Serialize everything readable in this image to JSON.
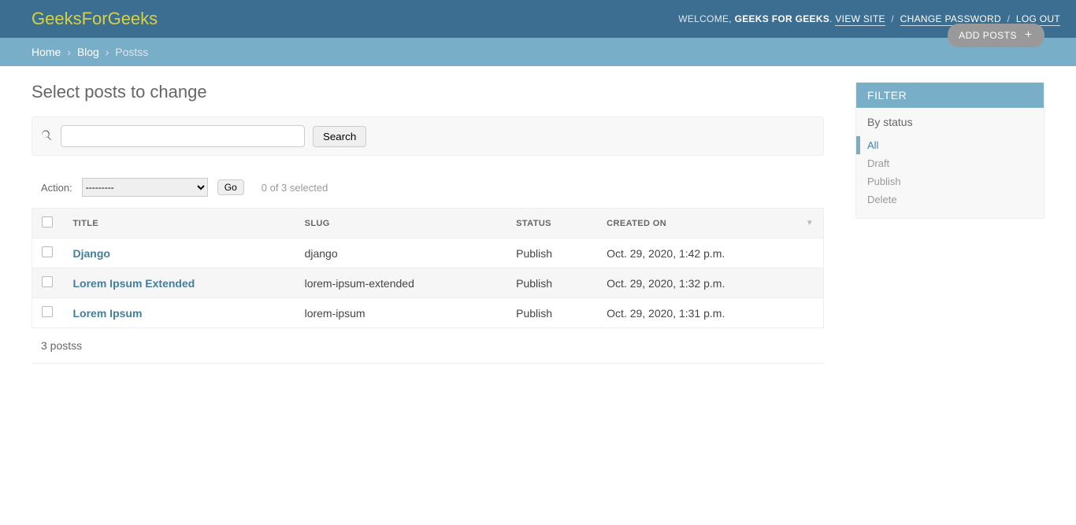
{
  "header": {
    "brand": "GeeksForGeeks",
    "welcome_prefix": "WELCOME, ",
    "username": "GEEKS FOR GEEKS",
    "view_site": "VIEW SITE",
    "change_password": "CHANGE PASSWORD",
    "logout": "LOG OUT"
  },
  "breadcrumb": {
    "items": [
      "Home",
      "Blog",
      "Postss"
    ]
  },
  "page": {
    "title": "Select posts to change",
    "add_button": "ADD POSTS"
  },
  "search": {
    "button": "Search"
  },
  "action": {
    "label": "Action:",
    "placeholder_option": "---------",
    "go": "Go",
    "selected_text": "0 of 3 selected"
  },
  "table": {
    "columns": [
      "TITLE",
      "SLUG",
      "STATUS",
      "CREATED ON"
    ],
    "rows": [
      {
        "title": "Django",
        "slug": "django",
        "status": "Publish",
        "created": "Oct. 29, 2020, 1:42 p.m."
      },
      {
        "title": "Lorem Ipsum Extended",
        "slug": "lorem-ipsum-extended",
        "status": "Publish",
        "created": "Oct. 29, 2020, 1:32 p.m."
      },
      {
        "title": "Lorem Ipsum",
        "slug": "lorem-ipsum",
        "status": "Publish",
        "created": "Oct. 29, 2020, 1:31 p.m."
      }
    ],
    "count_text": "3 postss"
  },
  "filter": {
    "heading": "FILTER",
    "subheading": "By status",
    "options": [
      "All",
      "Draft",
      "Publish",
      "Delete"
    ],
    "active_index": 0
  }
}
